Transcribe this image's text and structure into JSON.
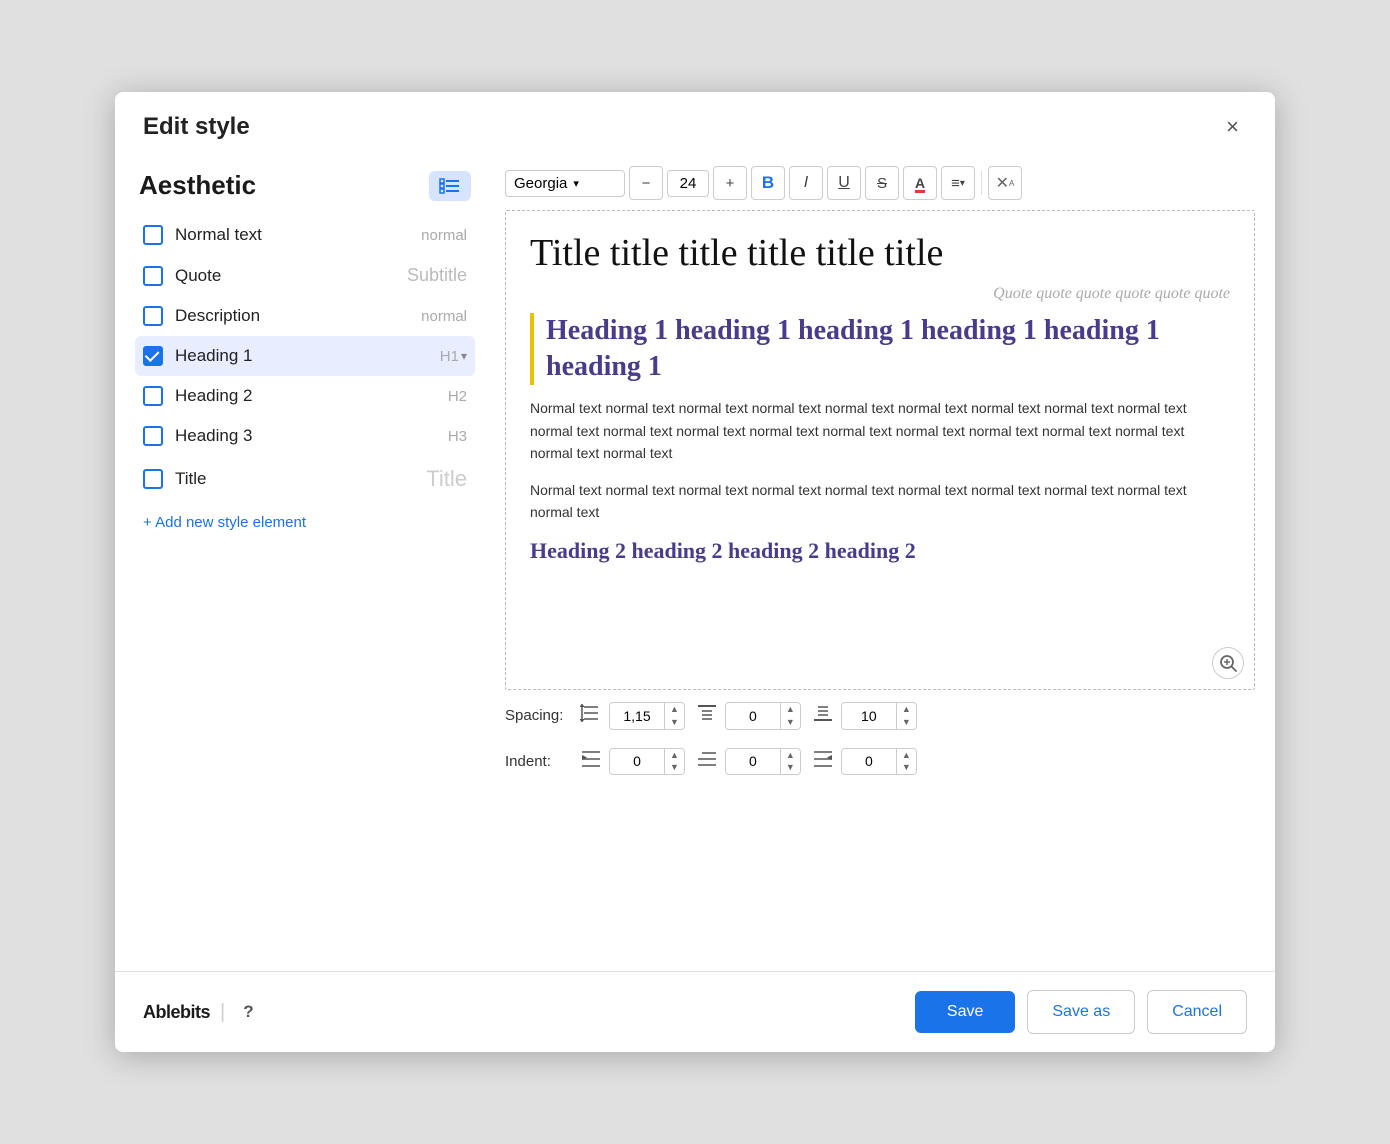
{
  "dialog": {
    "title": "Edit style",
    "close_label": "×"
  },
  "left_panel": {
    "heading": "Aesthetic",
    "checklist_label": "≡✓",
    "items": [
      {
        "id": "normal-text",
        "label": "Normal text",
        "preview": "normal",
        "preview_style": "normal",
        "checked": false
      },
      {
        "id": "quote",
        "label": "Quote",
        "preview": "Subtitle",
        "preview_style": "subtitle",
        "checked": false
      },
      {
        "id": "description",
        "label": "Description",
        "preview": "normal",
        "preview_style": "normal",
        "checked": false
      },
      {
        "id": "heading1",
        "label": "Heading 1",
        "preview": "H1",
        "preview_style": "h1",
        "checked": true,
        "selected": true
      },
      {
        "id": "heading2",
        "label": "Heading 2",
        "preview": "H2",
        "preview_style": "h2",
        "checked": false
      },
      {
        "id": "heading3",
        "label": "Heading 3",
        "preview": "H3",
        "preview_style": "h3",
        "checked": false
      },
      {
        "id": "title",
        "label": "Title",
        "preview": "Title",
        "preview_style": "title",
        "checked": false
      }
    ],
    "add_btn_label": "+ Add new style element"
  },
  "toolbar": {
    "font": "Georgia",
    "font_size": "24",
    "bold_label": "B",
    "italic_label": "I",
    "underline_label": "U",
    "strikethrough_label": "S",
    "font_color_label": "A",
    "align_label": "≡",
    "clear_label": "↗"
  },
  "preview": {
    "title_text": "Title title title title title title",
    "quote_text": "Quote quote quote quote quote quote",
    "heading1_text": "Heading 1 heading 1 heading 1 heading 1 heading 1 heading 1",
    "normal1_text": "Normal text normal text normal text normal text normal text normal text normal text normal text normal text normal text normal text normal text normal text normal text normal text normal text normal text normal text normal text normal text",
    "normal2_text": "Normal text normal text normal text normal text normal text normal text normal text normal text normal text normal text",
    "heading2_text": "Heading 2 heading 2 heading 2 heading 2"
  },
  "spacing": {
    "label": "Spacing:",
    "line_value": "1,15",
    "before_value": "0",
    "after_value": "10"
  },
  "indent": {
    "label": "Indent:",
    "left_value": "0",
    "first_value": "0",
    "right_value": "0"
  },
  "footer": {
    "brand": "Ablebits",
    "help_label": "?",
    "save_label": "Save",
    "save_as_label": "Save as",
    "cancel_label": "Cancel"
  }
}
